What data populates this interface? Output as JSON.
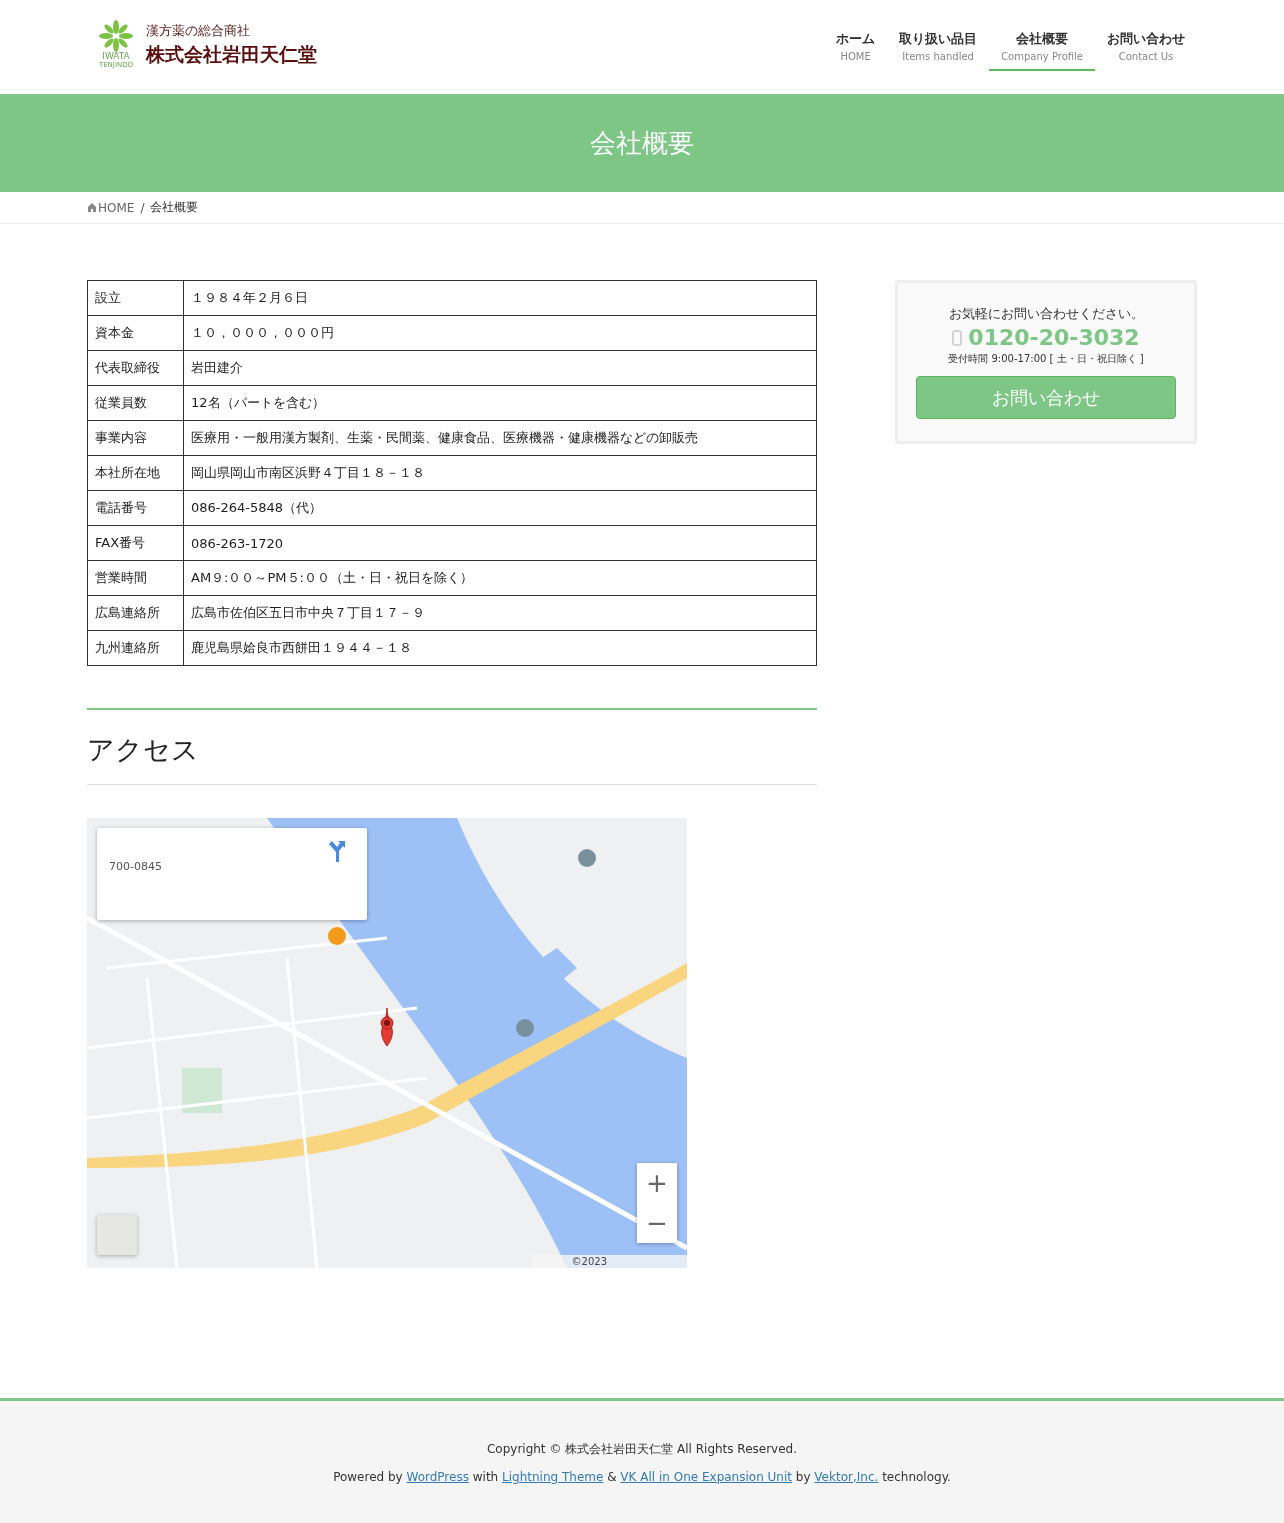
{
  "logo": {
    "tagline": "漢方薬の総合商社",
    "company": "株式会社岩田天仁堂",
    "mark_text": "IWATA",
    "mark_sub": "TENJINDO"
  },
  "nav": [
    {
      "label": "ホーム",
      "sub": "HOME",
      "selected": false
    },
    {
      "label": "取り扱い品目",
      "sub": "Items handled",
      "selected": false
    },
    {
      "label": "会社概要",
      "sub": "Company Profile",
      "selected": true
    },
    {
      "label": "お問い合わせ",
      "sub": "Contact Us",
      "selected": false
    }
  ],
  "page_title": "会社概要",
  "breadcrumb": [
    "HOME",
    "会社概要"
  ],
  "breadcrumb_separator": "/",
  "profile_table": [
    [
      "設立",
      "１９８４年２月６日"
    ],
    [
      "資本金",
      "１０，０００，０００円"
    ],
    [
      "代表取締役",
      "岩田建介"
    ],
    [
      "従業員数",
      "12名（パートを含む）"
    ],
    [
      "事業内容",
      "医療用・一般用漢方製剤、生薬・民間薬、健康食品、医療機器・健康機器などの卸販売"
    ],
    [
      "本社所在地",
      "岡山県岡山市南区浜野４丁目１８－１８"
    ],
    [
      "電話番号",
      "086-264-5848（代）"
    ],
    [
      "FAX番号",
      "086-263-1720"
    ],
    [
      "営業時間",
      "AM９:００～PM５:００（土・日・祝日を除く）"
    ],
    [
      "広島連絡所",
      "広島市佐伯区五日市中央７丁目１７－９"
    ],
    [
      "九州連絡所",
      "鹿児島県姶良市西餅田１９４４－１８"
    ]
  ],
  "access_heading": "アクセス",
  "map": {
    "kind": "picture",
    "card_address": "700-0845",
    "copyright": "©2023",
    "zoom_in": "+",
    "zoom_out": "−"
  },
  "contact_widget": {
    "lead": "お気軽にお問い合わせください。",
    "phone": "0120-20-3032",
    "hours": "受付時間 9:00-17:00 [ 土・日・祝日除く ]",
    "button": "お問い合わせ"
  },
  "footer": {
    "copyright": "Copyright © 株式会社岩田天仁堂 All Rights Reserved.",
    "powered": [
      {
        "kind": "text",
        "text": "Powered by "
      },
      {
        "kind": "link",
        "text": "WordPress"
      },
      {
        "kind": "text",
        "text": " with "
      },
      {
        "kind": "link",
        "text": "Lightning Theme"
      },
      {
        "kind": "text",
        "text": " & "
      },
      {
        "kind": "link",
        "text": "VK All in One Expansion Unit"
      },
      {
        "kind": "text",
        "text": " by "
      },
      {
        "kind": "link",
        "text": "Vektor,Inc."
      },
      {
        "kind": "text",
        "text": " technology."
      }
    ]
  }
}
